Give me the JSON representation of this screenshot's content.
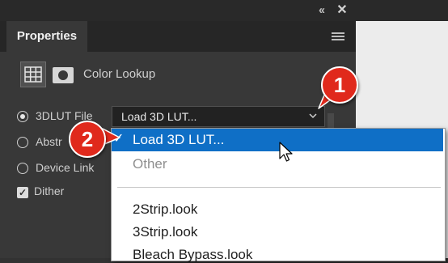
{
  "panel": {
    "tab_label": "Properties",
    "adjustment_title": "Color Lookup",
    "collapse_icon": "double-chevron-left-icon",
    "close_icon": "close-icon",
    "menu_icon": "hamburger-menu-icon"
  },
  "options": {
    "lut_3d_label": "3DLUT File",
    "abstract_label": "Abstr",
    "device_link_label": "Device Link",
    "dither_label": "Dither",
    "dither_checked": true
  },
  "select": {
    "value": "Load 3D LUT...",
    "chevron_icon": "chevron-down-icon"
  },
  "dropdown": {
    "selected": "Load 3D LUT...",
    "other": "Other",
    "items": [
      "2Strip.look",
      "3Strip.look",
      "Bleach Bypass.look"
    ]
  },
  "badges": {
    "one": "1",
    "two": "2"
  },
  "colors": {
    "badge_red": "#e0291c",
    "selection_blue": "#0f6fc6",
    "panel_bg": "#383838"
  }
}
